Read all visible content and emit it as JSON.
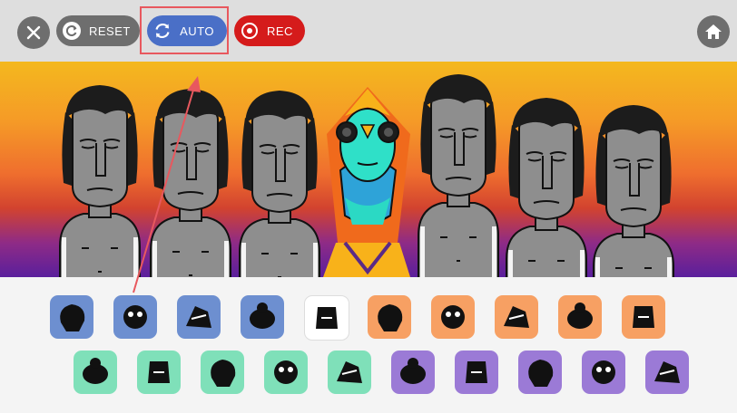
{
  "toolbar": {
    "close_icon": "close-icon",
    "reset_label": "RESET",
    "auto_label": "AUTO",
    "rec_label": "REC",
    "home_icon": "home-icon",
    "colors": {
      "bar": "#dedede",
      "gray": "#6e6e6e",
      "auto": "#4a6fc7",
      "rec": "#d51b1b",
      "highlight": "#e8585e"
    }
  },
  "stage": {
    "characters": [
      "performer-1",
      "performer-2",
      "performer-3",
      "performer-4-active",
      "performer-5",
      "performer-6",
      "performer-7"
    ]
  },
  "sound_tray": {
    "row1": [
      {
        "name": "beat-1",
        "color": "#6d8fd0"
      },
      {
        "name": "beat-2",
        "color": "#6d8fd0"
      },
      {
        "name": "beat-3",
        "color": "#6d8fd0"
      },
      {
        "name": "beat-4",
        "color": "#6d8fd0"
      },
      {
        "name": "effect-1",
        "color": "#ffffff"
      },
      {
        "name": "effect-2",
        "color": "#f7a063"
      },
      {
        "name": "effect-3",
        "color": "#f7a063"
      },
      {
        "name": "effect-4",
        "color": "#f7a063"
      },
      {
        "name": "effect-5",
        "color": "#f7a063"
      },
      {
        "name": "effect-6",
        "color": "#f7a063"
      }
    ],
    "row2": [
      {
        "name": "melody-1",
        "color": "#7fe0b9"
      },
      {
        "name": "melody-2",
        "color": "#7fe0b9"
      },
      {
        "name": "melody-3",
        "color": "#7fe0b9"
      },
      {
        "name": "melody-4",
        "color": "#7fe0b9"
      },
      {
        "name": "melody-5",
        "color": "#7fe0b9"
      },
      {
        "name": "voice-1",
        "color": "#9b7ad6"
      },
      {
        "name": "voice-2",
        "color": "#9b7ad6"
      },
      {
        "name": "voice-3",
        "color": "#9b7ad6"
      },
      {
        "name": "voice-4",
        "color": "#9b7ad6"
      },
      {
        "name": "voice-5",
        "color": "#9b7ad6"
      }
    ]
  }
}
